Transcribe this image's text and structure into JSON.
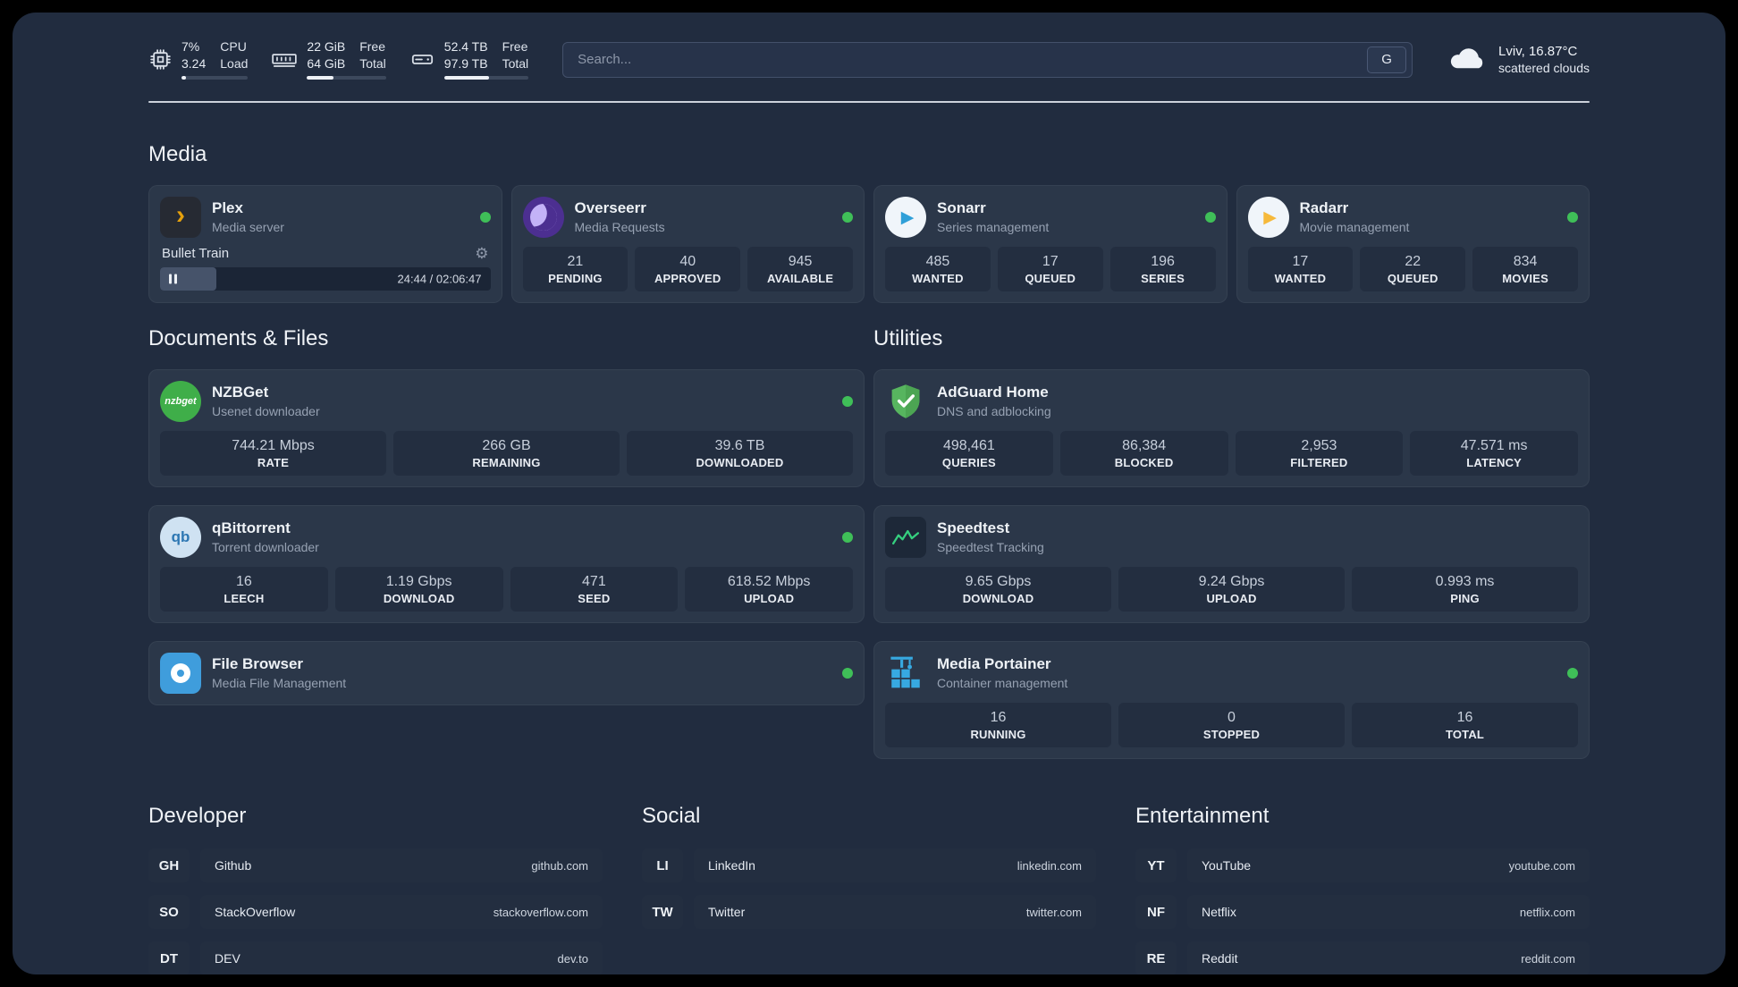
{
  "topbar": {
    "cpu": {
      "percent": "7%",
      "load": "3.24",
      "label_top": "CPU",
      "label_bottom": "Load"
    },
    "ram": {
      "free": "22 GiB",
      "total": "64 GiB",
      "label_top": "Free",
      "label_bottom": "Total"
    },
    "disk": {
      "free": "52.4 TB",
      "total": "97.9 TB",
      "label_top": "Free",
      "label_bottom": "Total"
    },
    "search": {
      "placeholder": "Search...",
      "engine": "G"
    },
    "weather": {
      "location": "Lviv, 16.87°C",
      "condition": "scattered clouds"
    }
  },
  "media": {
    "title": "Media",
    "plex": {
      "name": "Plex",
      "subtitle": "Media server",
      "player": {
        "track": "Bullet Train",
        "time": "24:44 / 02:06:47"
      }
    },
    "overseerr": {
      "name": "Overseerr",
      "subtitle": "Media Requests",
      "stats": [
        {
          "value": "21",
          "label": "PENDING"
        },
        {
          "value": "40",
          "label": "APPROVED"
        },
        {
          "value": "945",
          "label": "AVAILABLE"
        }
      ]
    },
    "sonarr": {
      "name": "Sonarr",
      "subtitle": "Series management",
      "stats": [
        {
          "value": "485",
          "label": "WANTED"
        },
        {
          "value": "17",
          "label": "QUEUED"
        },
        {
          "value": "196",
          "label": "SERIES"
        }
      ]
    },
    "radarr": {
      "name": "Radarr",
      "subtitle": "Movie management",
      "stats": [
        {
          "value": "17",
          "label": "WANTED"
        },
        {
          "value": "22",
          "label": "QUEUED"
        },
        {
          "value": "834",
          "label": "MOVIES"
        }
      ]
    }
  },
  "documents": {
    "title": "Documents & Files",
    "nzbget": {
      "name": "NZBGet",
      "subtitle": "Usenet downloader",
      "icon_text": "nzbget",
      "stats": [
        {
          "value": "744.21 Mbps",
          "label": "RATE"
        },
        {
          "value": "266 GB",
          "label": "REMAINING"
        },
        {
          "value": "39.6 TB",
          "label": "DOWNLOADED"
        }
      ]
    },
    "qbittorrent": {
      "name": "qBittorrent",
      "subtitle": "Torrent downloader",
      "icon_text": "qb",
      "stats": [
        {
          "value": "16",
          "label": "LEECH"
        },
        {
          "value": "1.19 Gbps",
          "label": "DOWNLOAD"
        },
        {
          "value": "471",
          "label": "SEED"
        },
        {
          "value": "618.52 Mbps",
          "label": "UPLOAD"
        }
      ]
    },
    "filebrowser": {
      "name": "File Browser",
      "subtitle": "Media File Management"
    }
  },
  "utilities": {
    "title": "Utilities",
    "adguard": {
      "name": "AdGuard Home",
      "subtitle": "DNS and adblocking",
      "stats": [
        {
          "value": "498,461",
          "label": "QUERIES"
        },
        {
          "value": "86,384",
          "label": "BLOCKED"
        },
        {
          "value": "2,953",
          "label": "FILTERED"
        },
        {
          "value": "47.571 ms",
          "label": "LATENCY"
        }
      ]
    },
    "speedtest": {
      "name": "Speedtest",
      "subtitle": "Speedtest Tracking",
      "stats": [
        {
          "value": "9.65 Gbps",
          "label": "DOWNLOAD"
        },
        {
          "value": "9.24 Gbps",
          "label": "UPLOAD"
        },
        {
          "value": "0.993 ms",
          "label": "PING"
        }
      ]
    },
    "portainer": {
      "name": "Media Portainer",
      "subtitle": "Container management",
      "stats": [
        {
          "value": "16",
          "label": "RUNNING"
        },
        {
          "value": "0",
          "label": "STOPPED"
        },
        {
          "value": "16",
          "label": "TOTAL"
        }
      ]
    }
  },
  "bookmarks": {
    "developer": {
      "title": "Developer",
      "items": [
        {
          "abbr": "GH",
          "name": "Github",
          "url": "github.com"
        },
        {
          "abbr": "SO",
          "name": "StackOverflow",
          "url": "stackoverflow.com"
        },
        {
          "abbr": "DT",
          "name": "DEV",
          "url": "dev.to"
        }
      ]
    },
    "social": {
      "title": "Social",
      "items": [
        {
          "abbr": "LI",
          "name": "LinkedIn",
          "url": "linkedin.com"
        },
        {
          "abbr": "TW",
          "name": "Twitter",
          "url": "twitter.com"
        }
      ]
    },
    "entertainment": {
      "title": "Entertainment",
      "items": [
        {
          "abbr": "YT",
          "name": "YouTube",
          "url": "youtube.com"
        },
        {
          "abbr": "NF",
          "name": "Netflix",
          "url": "netflix.com"
        },
        {
          "abbr": "RE",
          "name": "Reddit",
          "url": "reddit.com"
        }
      ]
    }
  }
}
